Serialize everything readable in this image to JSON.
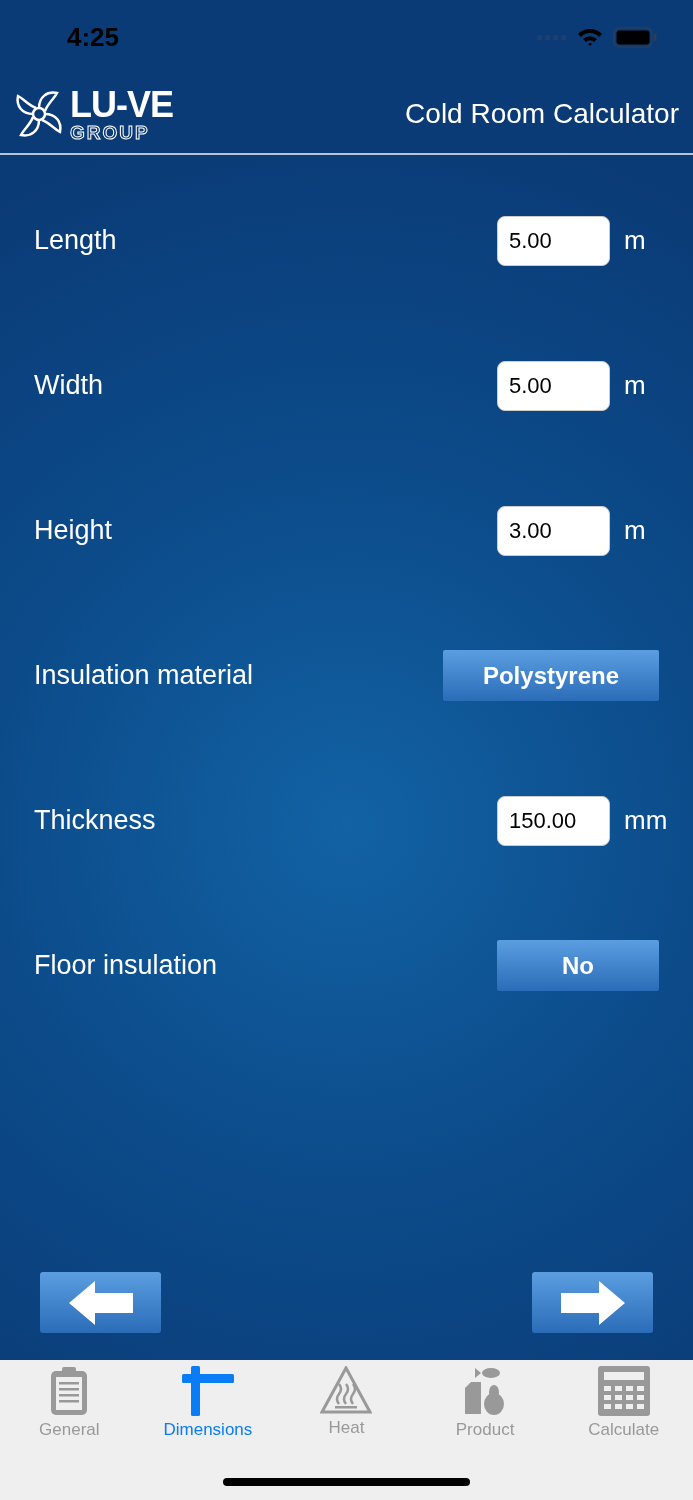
{
  "status_bar": {
    "time": "4:25"
  },
  "header": {
    "logo_text": "LU-VE",
    "logo_subtext": "GROUP",
    "title": "Cold Room Calculator"
  },
  "fields": [
    {
      "kind": "input",
      "label": "Length",
      "value": "5.00",
      "unit": "m"
    },
    {
      "kind": "input",
      "label": "Width",
      "value": "5.00",
      "unit": "m"
    },
    {
      "kind": "input",
      "label": "Height",
      "value": "3.00",
      "unit": "m"
    },
    {
      "kind": "select",
      "label": "Insulation material",
      "value": "Polystyrene"
    },
    {
      "kind": "input",
      "label": "Thickness",
      "value": "150.00",
      "unit": "mm"
    },
    {
      "kind": "toggle",
      "label": "Floor insulation",
      "value": "No"
    }
  ],
  "tabs": [
    {
      "label": "General",
      "selected": false
    },
    {
      "label": "Dimensions",
      "selected": true
    },
    {
      "label": "Heat",
      "selected": false
    },
    {
      "label": "Product",
      "selected": false
    },
    {
      "label": "Calculate",
      "selected": false
    }
  ]
}
